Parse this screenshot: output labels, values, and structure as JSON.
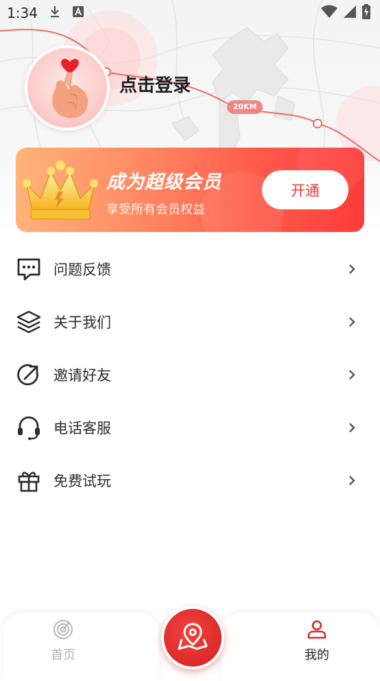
{
  "status_bar": {
    "time": "1:34",
    "icons": [
      "download-icon",
      "text-a-icon",
      "wifi-icon",
      "signal-icon",
      "battery-charging-icon"
    ]
  },
  "map": {
    "distance_label": "20KM"
  },
  "profile": {
    "login_text": "点击登录"
  },
  "vip": {
    "title": "成为超级会员",
    "subtitle": "享受所有会员权益",
    "button_label": "开通"
  },
  "menu": {
    "items": [
      {
        "label": "问题反馈",
        "icon": "feedback-chat-icon"
      },
      {
        "label": "关于我们",
        "icon": "layers-icon"
      },
      {
        "label": "邀请好友",
        "icon": "share-arrow-icon"
      },
      {
        "label": "电话客服",
        "icon": "headset-icon"
      },
      {
        "label": "免费试玩",
        "icon": "gift-icon"
      }
    ]
  },
  "tabbar": {
    "home_label": "首页",
    "mine_label": "我的",
    "colors": {
      "active": "#d62a2a",
      "inactive": "#b5b5b5"
    }
  },
  "colors": {
    "accent": "#e63a35",
    "vip_gradient_start": "#ffb37a",
    "vip_gradient_end": "#ff3b3b"
  }
}
